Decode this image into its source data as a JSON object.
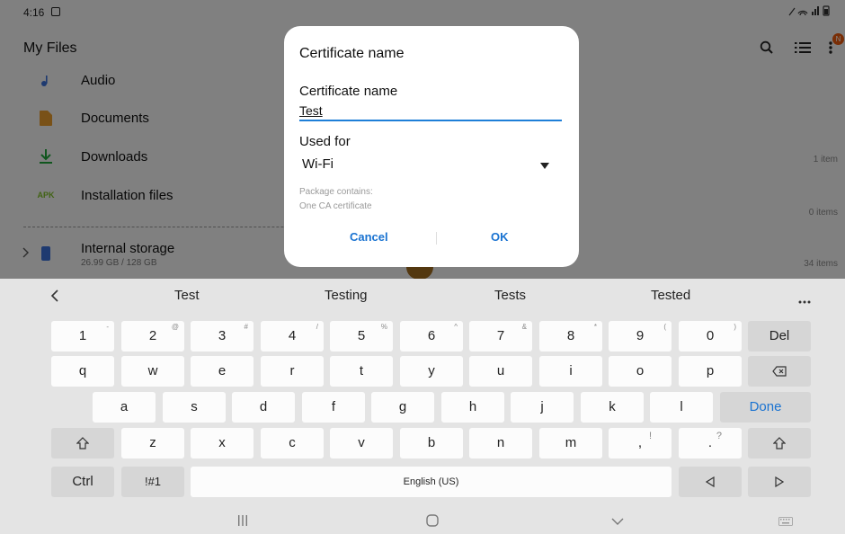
{
  "status_bar": {
    "time": "4:16"
  },
  "app": {
    "title": "My Files",
    "rows": [
      {
        "label": "Audio",
        "icon": "music-note-icon",
        "color": "#3b6fd6"
      },
      {
        "label": "Documents",
        "icon": "document-icon",
        "color": "#e89c2c"
      },
      {
        "label": "Downloads",
        "icon": "download-icon",
        "color": "#1fa53b"
      },
      {
        "label": "Installation files",
        "icon": "apk-icon",
        "icon_text": "APK",
        "color": "#7fbf2a"
      }
    ],
    "counts": [
      "1 item",
      "0 items"
    ],
    "storage": {
      "label": "Internal storage",
      "detail": "26.99 GB / 128 GB",
      "count": "34 items",
      "icon": "phone-icon"
    },
    "badge": "N"
  },
  "dialog": {
    "title": "Certificate name",
    "name_label": "Certificate name",
    "name_value": "Test",
    "used_for_label": "Used for",
    "used_for_value": "Wi-Fi",
    "package_line1": "Package contains:",
    "package_line2": "One CA certificate",
    "cancel": "Cancel",
    "ok": "OK",
    "accent": "#1a73d1"
  },
  "suggestions": [
    "Test",
    "Testing",
    "Tests",
    "Tested"
  ],
  "keyboard": {
    "row1": [
      {
        "k": "1",
        "s": "-"
      },
      {
        "k": "2",
        "s": "@"
      },
      {
        "k": "3",
        "s": "#"
      },
      {
        "k": "4",
        "s": "/"
      },
      {
        "k": "5",
        "s": "%"
      },
      {
        "k": "6",
        "s": "^"
      },
      {
        "k": "7",
        "s": "&"
      },
      {
        "k": "8",
        "s": "*"
      },
      {
        "k": "9",
        "s": "("
      },
      {
        "k": "0",
        "s": ")"
      }
    ],
    "del": "Del",
    "row2": [
      "q",
      "w",
      "e",
      "r",
      "t",
      "y",
      "u",
      "i",
      "o",
      "p"
    ],
    "row3": [
      "a",
      "s",
      "d",
      "f",
      "g",
      "h",
      "j",
      "k",
      "l"
    ],
    "done": "Done",
    "row4": [
      "z",
      "x",
      "c",
      "v",
      "b",
      "n",
      "m"
    ],
    "comma": {
      "k": ",",
      "s": "!"
    },
    "period": {
      "k": ".",
      "s": "?"
    },
    "ctrl": "Ctrl",
    "sym": "!#1",
    "space": "English (US)"
  }
}
